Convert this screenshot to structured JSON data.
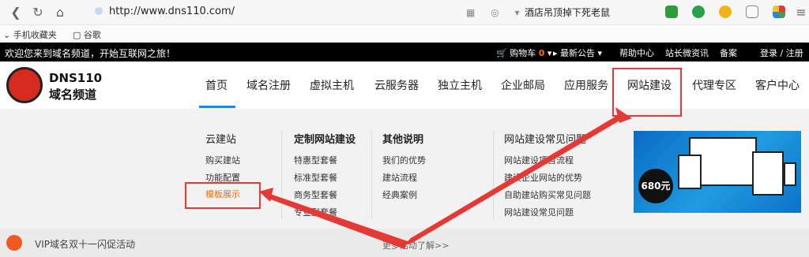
{
  "browser": {
    "url": "http://www.dns110.com/",
    "search_text": "酒店吊顶掉下死老鼠",
    "bookmarks": [
      "手机收藏夹",
      "谷歌"
    ]
  },
  "topbar": {
    "welcome": "欢迎您来到域名频道，开始互联网之旅！",
    "cart_label": "购物车",
    "cart_count": "0",
    "announcement": "最新公告",
    "help": "帮助中心",
    "webmaster": "站长微资讯",
    "record": "备案",
    "login": "登录 / 注册"
  },
  "logo": {
    "line1": "DNS110",
    "line2": "域名频道"
  },
  "nav": {
    "items": [
      "首页",
      "域名注册",
      "虚拟主机",
      "云服务器",
      "独立主机",
      "企业邮局",
      "应用服务",
      "网站建设",
      "代理专区",
      "客户中心"
    ]
  },
  "dropdown": {
    "columns": [
      {
        "title": "云建站",
        "links": [
          "购买建站",
          "功能配置",
          "模板展示"
        ]
      },
      {
        "title": "定制网站建设",
        "links": [
          "特惠型套餐",
          "标准型套餐",
          "商务型套餐",
          "专业型套餐"
        ]
      },
      {
        "title": "其他说明",
        "links": [
          "我们的优势",
          "建站流程",
          "经典案例"
        ]
      },
      {
        "title": "网站建设常见问题",
        "links": [
          "网站建设项目流程",
          "建设企业网站的优势",
          "自助建站购买常见问题",
          "网站建设常见问题"
        ]
      }
    ],
    "banner_price": "680元"
  },
  "promo": {
    "text": "VIP域名双十一闪促活动",
    "more": "更多活动了解>>"
  },
  "colors": {
    "accent_blue": "#1e88e5",
    "highlight_orange": "#ff6a00",
    "annotation_red": "#e53935"
  }
}
